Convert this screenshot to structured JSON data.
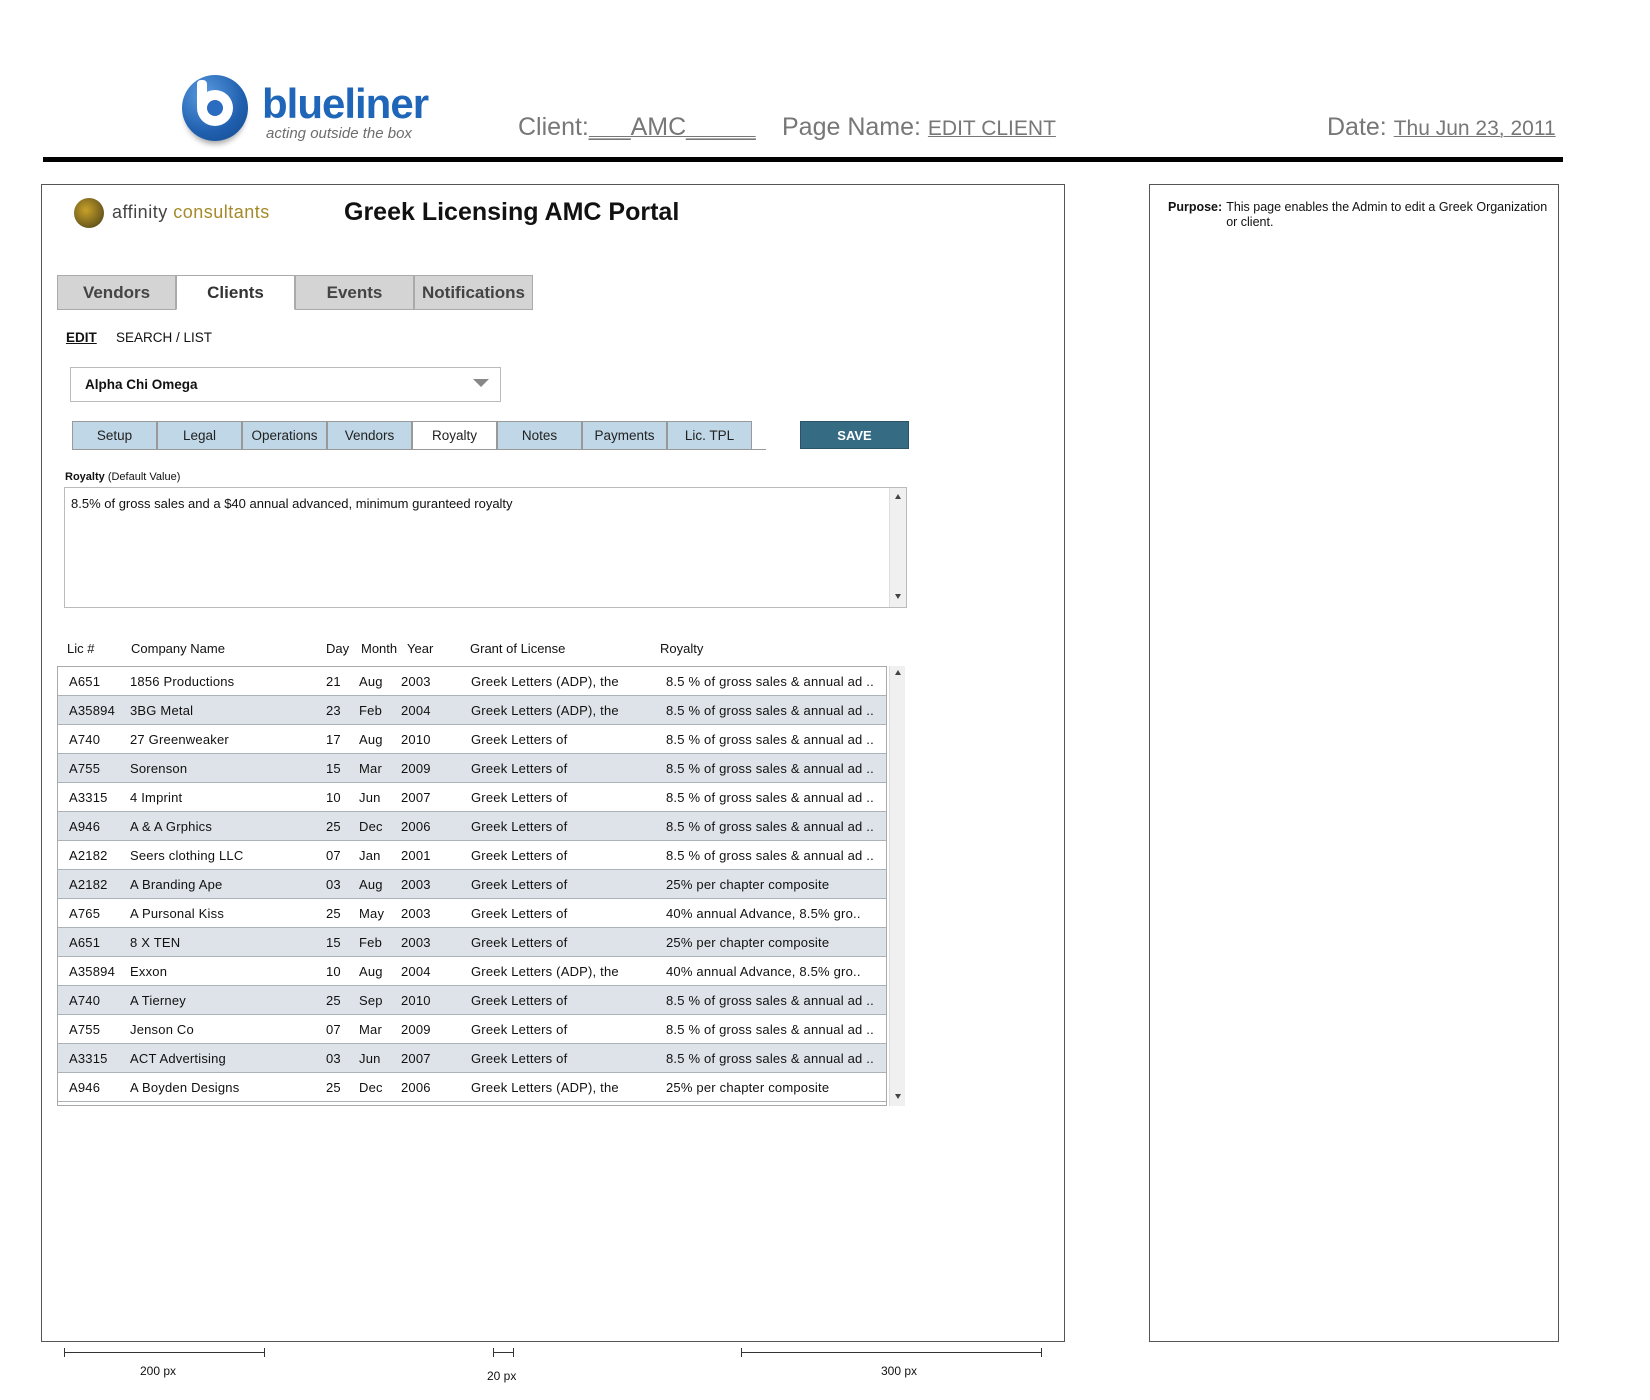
{
  "header": {
    "brand_name": "blueliner",
    "brand_tagline": "acting outside the box",
    "client_label": "Client:",
    "client_value": "___AMC_____",
    "page_name_label": "Page Name:",
    "page_name_value": "EDIT CLIENT",
    "date_label": "Date:",
    "date_value": "Thu Jun 23, 2011"
  },
  "app": {
    "logo_text_1": "affinity",
    "logo_text_2": "consultants",
    "title": "Greek Licensing AMC Portal"
  },
  "top_tabs": [
    {
      "label": "Vendors",
      "active": false
    },
    {
      "label": "Clients",
      "active": true
    },
    {
      "label": "Events",
      "active": false
    },
    {
      "label": "Notifications",
      "active": false
    }
  ],
  "sub_nav": {
    "edit": "EDIT",
    "search": "SEARCH / LIST"
  },
  "org_select": {
    "value": "Alpha Chi Omega",
    "icon": "chevron-down-icon"
  },
  "sub_tabs": [
    {
      "label": "Setup",
      "active": false
    },
    {
      "label": "Legal",
      "active": false
    },
    {
      "label": "Operations",
      "active": false
    },
    {
      "label": "Vendors",
      "active": false
    },
    {
      "label": "Royalty",
      "active": true
    },
    {
      "label": "Notes",
      "active": false
    },
    {
      "label": "Payments",
      "active": false
    },
    {
      "label": "Lic. TPL",
      "active": false
    }
  ],
  "save_label": "SAVE",
  "royalty": {
    "label_bold": "Royalty",
    "label_note": "(Default Value)",
    "text": "8.5% of gross sales and a $40 annual advanced, minimum guranteed royalty"
  },
  "table": {
    "columns": [
      "Lic #",
      "Company Name",
      "Day",
      "Month",
      "Year",
      "Grant of License",
      "Royalty"
    ],
    "rows": [
      [
        "A651",
        "1856 Productions",
        "21",
        "Aug",
        "2003",
        "Greek Letters (ADP), the",
        "8.5 % of gross sales & annual ad .."
      ],
      [
        "A35894",
        "3BG Metal",
        "23",
        "Feb",
        "2004",
        "Greek Letters (ADP), the",
        "8.5 % of gross sales & annual ad .."
      ],
      [
        "A740",
        "27 Greenweaker",
        "17",
        "Aug",
        "2010",
        "Greek Letters  of",
        "8.5 % of gross sales & annual ad .."
      ],
      [
        "A755",
        "Sorenson",
        "15",
        "Mar",
        "2009",
        "Greek Letters  of",
        "8.5 % of gross sales & annual ad .."
      ],
      [
        "A3315",
        "4 Imprint",
        "10",
        "Jun",
        "2007",
        "Greek Letters  of",
        "8.5 % of gross sales & annual ad .."
      ],
      [
        "A946",
        "A & A Grphics",
        "25",
        "Dec",
        "2006",
        "Greek Letters  of",
        "8.5 % of gross sales & annual ad .."
      ],
      [
        "A2182",
        "Seers clothing LLC",
        "07",
        "Jan",
        "2001",
        "Greek Letters  of",
        "8.5 % of gross sales & annual ad .."
      ],
      [
        "A2182",
        "A Branding Ape",
        "03",
        "Aug",
        "2003",
        "Greek Letters  of",
        "25% per chapter composite"
      ],
      [
        "A765",
        "A Pursonal Kiss",
        "25",
        "May",
        "2003",
        "Greek Letters  of",
        "40% annual Advance, 8.5% gro.."
      ],
      [
        "A651",
        "8 X TEN",
        "15",
        "Feb",
        "2003",
        "Greek Letters  of",
        "25% per chapter composite"
      ],
      [
        "A35894",
        "Exxon",
        "10",
        "Aug",
        "2004",
        "Greek Letters (ADP), the",
        "40% annual Advance, 8.5% gro.."
      ],
      [
        "A740",
        "A Tierney",
        "25",
        "Sep",
        "2010",
        "Greek Letters  of",
        "8.5 % of gross sales & annual ad .."
      ],
      [
        "A755",
        "Jenson Co",
        "07",
        "Mar",
        "2009",
        "Greek Letters  of",
        "8.5 % of gross sales & annual ad .."
      ],
      [
        "A3315",
        "ACT Advertising",
        "03",
        "Jun",
        "2007",
        "Greek Letters  of",
        "8.5 % of gross sales & annual ad .."
      ],
      [
        "A946",
        "A Boyden Designs",
        "25",
        "Dec",
        "2006",
        "Greek Letters (ADP), the",
        "25% per chapter composite"
      ]
    ]
  },
  "purpose": {
    "label": "Purpose:",
    "text": "This page enables the Admin to edit a Greek Organization or client."
  },
  "measurements": [
    "200 px",
    "20 px",
    "300 px"
  ]
}
